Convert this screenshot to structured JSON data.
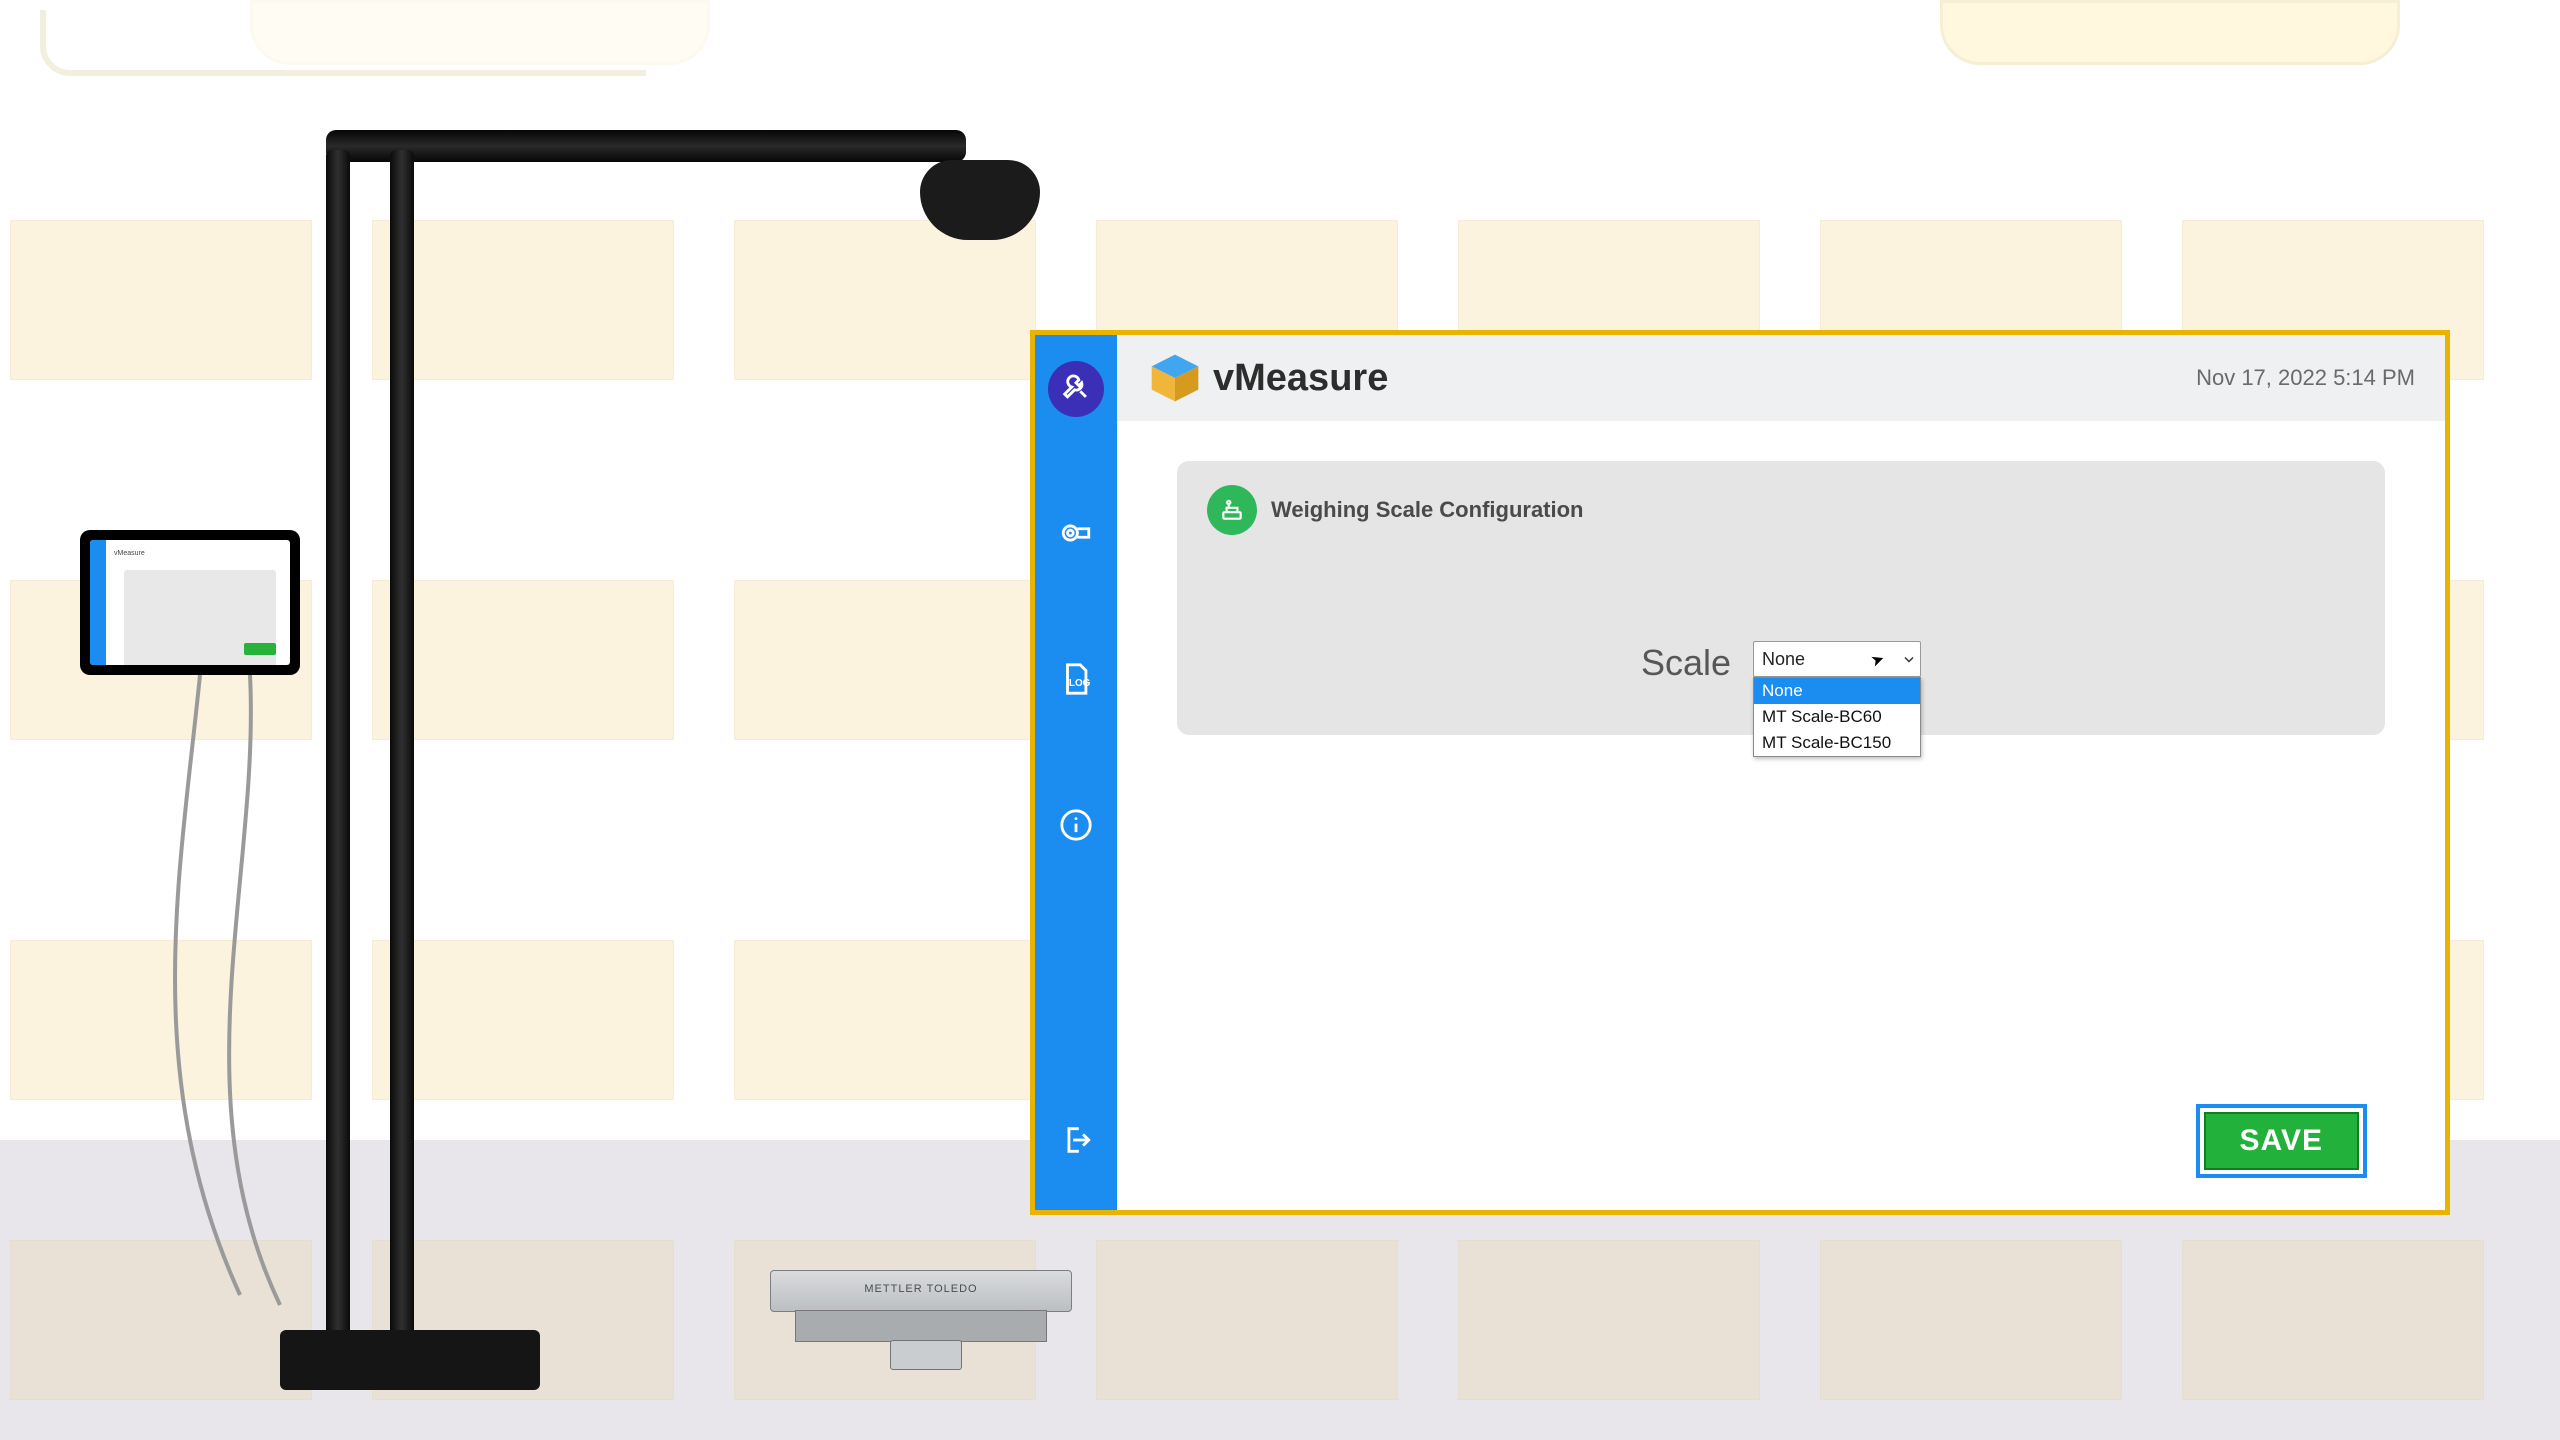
{
  "header": {
    "app_name": "vMeasure",
    "datetime": "Nov 17, 2022 5:14 PM"
  },
  "sidebar": {
    "settings_icon": "settings",
    "camera_icon": "camera",
    "log_icon": "LOG",
    "info_icon": "info",
    "logout_icon": "logout"
  },
  "config_card": {
    "title": "Weighing Scale Configuration",
    "icon": "scale",
    "field_label": "Scale",
    "dropdown": {
      "selected": "None",
      "options": [
        "None",
        "MT Scale-BC60",
        "MT Scale-BC150"
      ]
    }
  },
  "footer": {
    "save_label": "SAVE"
  },
  "hardware": {
    "scale_brand": "METTLER TOLEDO",
    "tablet_app": "vMeasure"
  }
}
